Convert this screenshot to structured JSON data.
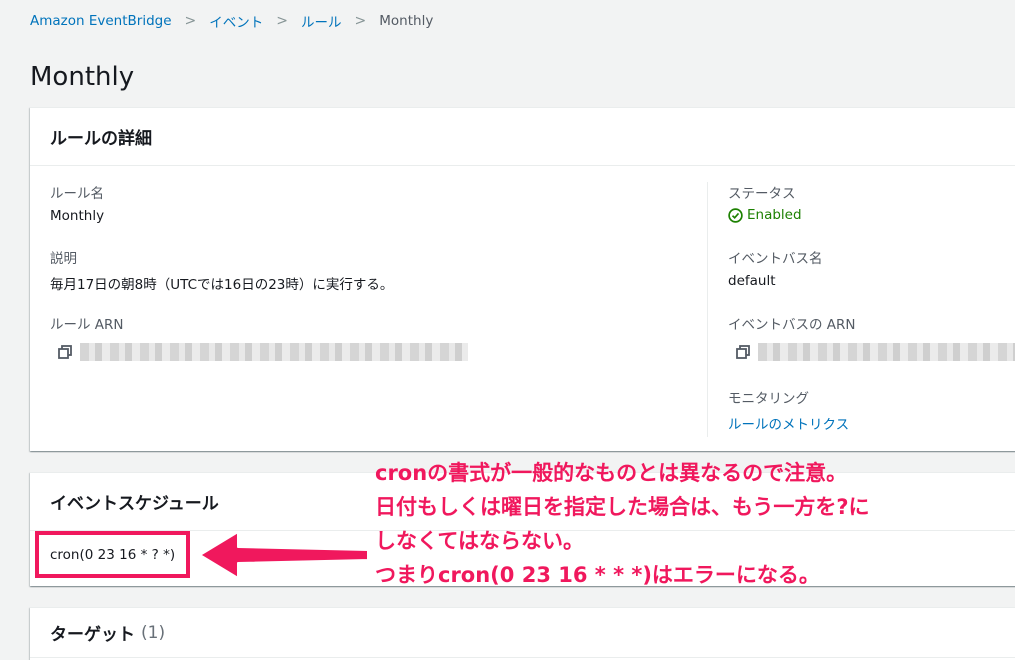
{
  "breadcrumb": {
    "items": [
      "Amazon EventBridge",
      "イベント",
      "ルール",
      "Monthly"
    ],
    "separator": ">"
  },
  "page": {
    "title": "Monthly"
  },
  "details": {
    "header": "ルールの詳細",
    "rule_name_label": "ルール名",
    "rule_name": "Monthly",
    "description_label": "説明",
    "description": "毎月17日の朝8時（UTCでは16日の23時）に実行する。",
    "rule_arn_label": "ルール ARN",
    "status_label": "ステータス",
    "status": "Enabled",
    "event_bus_label": "イベントバス名",
    "event_bus": "default",
    "event_bus_arn_label": "イベントバスの ARN",
    "monitoring_label": "モニタリング",
    "monitoring_link": "ルールのメトリクス"
  },
  "schedule": {
    "header": "イベントスケジュール",
    "cron": "cron(0 23 16 * ? *)"
  },
  "target": {
    "header": "ターゲット",
    "count": "(1)"
  },
  "annotation": {
    "lines": [
      "cronの書式が一般的なものとは異なるので注意。",
      "日付もしくは曜日を指定した場合は、もう一方を?に",
      "しなくてはならない。",
      "つまりcron(0 23 16 * * *)はエラーになる。"
    ],
    "color": "#f0185d"
  },
  "colors": {
    "link": "#0073bb",
    "status_ok": "#1d8102",
    "background": "#f2f3f3"
  }
}
